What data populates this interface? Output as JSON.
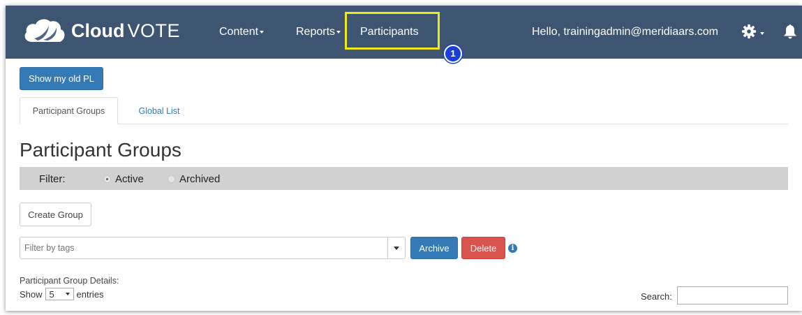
{
  "navbar": {
    "brand_bold": "Cloud",
    "brand_light": "VOTE",
    "items": [
      {
        "label": "Content",
        "has_caret": true
      },
      {
        "label": "Reports",
        "has_caret": true
      },
      {
        "label": "Participants",
        "has_caret": false
      }
    ],
    "greeting": "Hello, trainingadmin@meridiaars.com",
    "settings_icon": "gear-icon",
    "notifications_icon": "bell-icon",
    "background_color": "#3e5572"
  },
  "annotation": {
    "step_number": "1",
    "highlight_color": "#f0e81c",
    "badge_color": "#1a3fd6"
  },
  "toolbar": {
    "show_old_pl_label": "Show my old PL"
  },
  "tabs": [
    {
      "label": "Participant Groups",
      "active": true
    },
    {
      "label": "Global List",
      "active": false
    }
  ],
  "page": {
    "title": "Participant Groups"
  },
  "filter": {
    "label": "Filter:",
    "options": [
      {
        "label": "Active",
        "checked": true
      },
      {
        "label": "Archived",
        "checked": false
      }
    ]
  },
  "actions": {
    "create_group_label": "Create Group",
    "tags_placeholder": "Filter by tags",
    "archive_label": "Archive",
    "delete_label": "Delete",
    "info_icon": "info-icon"
  },
  "table_controls": {
    "details_label": "Participant Group Details:",
    "show_label": "Show",
    "entries_value": "5",
    "entries_label": "entries",
    "search_label": "Search:",
    "search_value": ""
  },
  "colors": {
    "primary": "#337ab7",
    "danger": "#d9534f",
    "filter_bar": "#d1d1d1"
  }
}
